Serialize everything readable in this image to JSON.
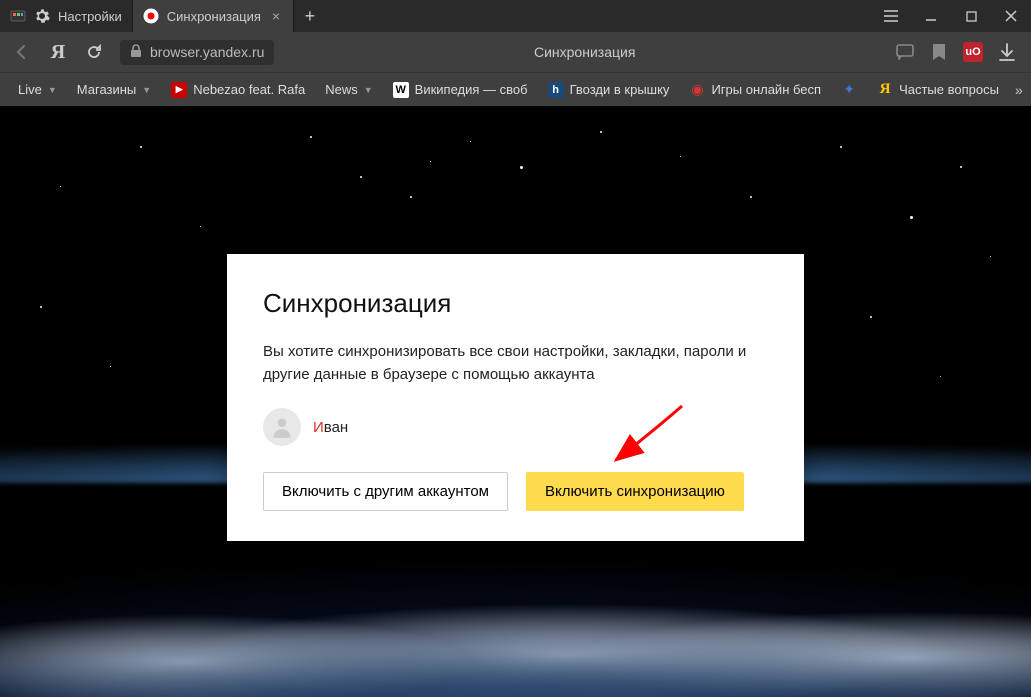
{
  "tabs": [
    {
      "label": "Настройки",
      "icon": "gear",
      "active": false
    },
    {
      "label": "Синхронизация",
      "icon": "yandex-red",
      "active": true
    }
  ],
  "addressbar": {
    "url": "browser.yandex.ru",
    "page_title": "Синхронизация"
  },
  "bookmarks": [
    {
      "label": "Live",
      "dropdown": true
    },
    {
      "label": "Магазины",
      "dropdown": true
    },
    {
      "label": "Nebezao feat. Rafa",
      "icon": "youtube"
    },
    {
      "label": "News",
      "dropdown": true
    },
    {
      "label": "Википедия — своб",
      "icon": "wikipedia"
    },
    {
      "label": "Гвозди в крышку",
      "icon": "h-blue"
    },
    {
      "label": "Игры онлайн бесп",
      "icon": "game-red"
    },
    {
      "label": "",
      "icon": "puzzle"
    },
    {
      "label": "Частые вопросы",
      "icon": "yandex-y"
    }
  ],
  "dialog": {
    "title": "Синхронизация",
    "description": "Вы хотите синхронизировать все свои настройки, закладки, пароли и другие данные в браузере с помощью аккаунта",
    "user_first_letter": "И",
    "user_rest": "ван",
    "btn_other": "Включить с другим аккаунтом",
    "btn_enable": "Включить синхронизацию"
  },
  "extension": {
    "ublock": "uO"
  }
}
